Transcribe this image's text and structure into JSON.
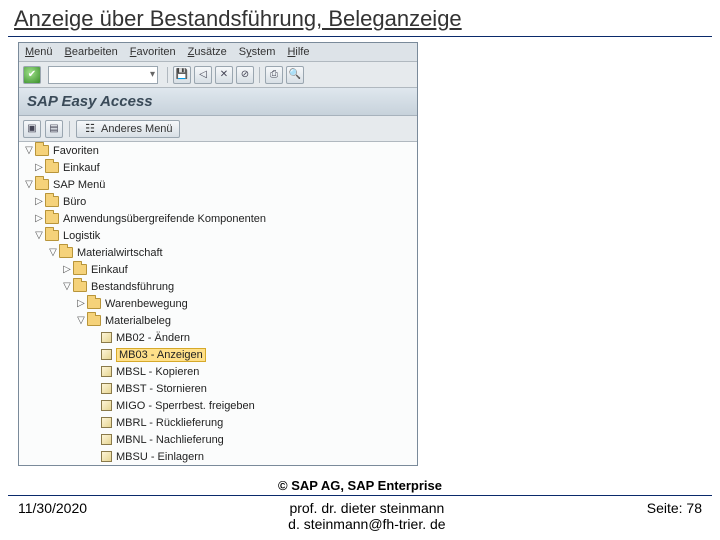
{
  "slide": {
    "title": "Anzeige über Bestandsführung, Beleganzeige",
    "copyright": "© SAP AG, SAP Enterprise",
    "date": "11/30/2020",
    "professor": "prof. dr. dieter steinmann",
    "email": "d. steinmann@fh-trier. de",
    "page_label": "Seite: 78"
  },
  "menubar": {
    "menu": "Menü",
    "bearbeiten": "Bearbeiten",
    "favoriten": "Favoriten",
    "zusaetze": "Zusätze",
    "system": "System",
    "hilfe": "Hilfe"
  },
  "window_title": "SAP Easy Access",
  "toolbar2": {
    "other_menu": "Anderes Menü"
  },
  "tree": {
    "favoriten": "Favoriten",
    "einkauf_fav": "Einkauf",
    "sap_menu": "SAP Menü",
    "buero": "Büro",
    "anwend": "Anwendungsübergreifende Komponenten",
    "logistik": "Logistik",
    "materialw": "Materialwirtschaft",
    "einkauf": "Einkauf",
    "bestand": "Bestandsführung",
    "warenbew": "Warenbewegung",
    "matbeleg": "Materialbeleg",
    "mb02": "MB02 - Ändern",
    "mb03": "MB03 - Anzeigen",
    "mbsl": "MBSL - Kopieren",
    "mbst": "MBST - Stornieren",
    "migo": "MIGO - Sperrbest. freigeben",
    "mbrl": "MBRL - Rücklieferung",
    "mbnl": "MBNL - Nachlieferung",
    "mbsu": "MBSU - Einlagern"
  }
}
